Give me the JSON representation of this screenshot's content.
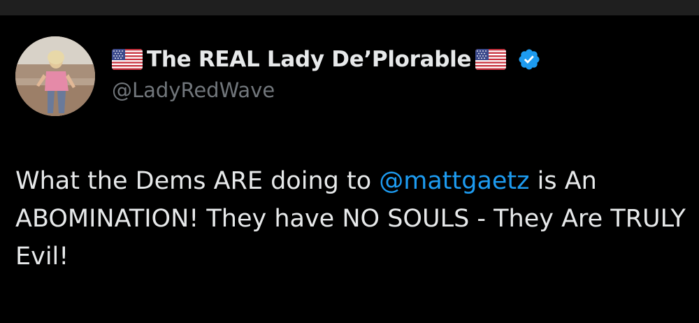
{
  "author": {
    "display_name": "The REAL Lady De’Plorable",
    "handle": "@LadyRedWave",
    "verified": true,
    "verified_color": "#1d9bf0",
    "name_decorations": [
      "us-flag-icon",
      "us-flag-icon"
    ]
  },
  "tweet": {
    "text_before_mention": "What the Dems ARE doing to ",
    "mention": "@mattgaetz",
    "text_after_mention": " is An ABOMINATION! They have NO SOULS - They Are TRULY Evil!"
  },
  "colors": {
    "background": "#000000",
    "text": "#e7e9ea",
    "secondary_text": "#71767b",
    "link": "#1d9bf0"
  }
}
